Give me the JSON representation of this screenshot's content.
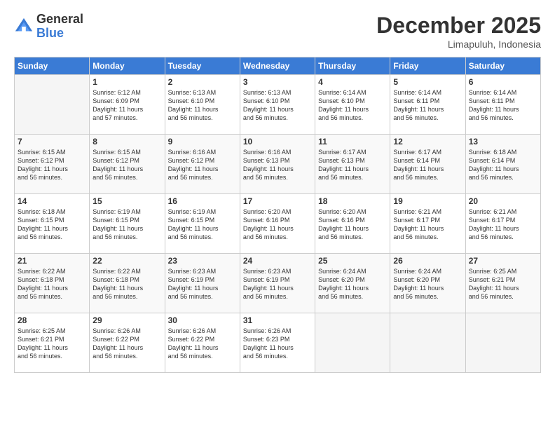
{
  "logo": {
    "general": "General",
    "blue": "Blue"
  },
  "title": "December 2025",
  "location": "Limapuluh, Indonesia",
  "days_header": [
    "Sunday",
    "Monday",
    "Tuesday",
    "Wednesday",
    "Thursday",
    "Friday",
    "Saturday"
  ],
  "weeks": [
    [
      {
        "day": "",
        "info": ""
      },
      {
        "day": "1",
        "info": "Sunrise: 6:12 AM\nSunset: 6:09 PM\nDaylight: 11 hours\nand 57 minutes."
      },
      {
        "day": "2",
        "info": "Sunrise: 6:13 AM\nSunset: 6:10 PM\nDaylight: 11 hours\nand 56 minutes."
      },
      {
        "day": "3",
        "info": "Sunrise: 6:13 AM\nSunset: 6:10 PM\nDaylight: 11 hours\nand 56 minutes."
      },
      {
        "day": "4",
        "info": "Sunrise: 6:14 AM\nSunset: 6:10 PM\nDaylight: 11 hours\nand 56 minutes."
      },
      {
        "day": "5",
        "info": "Sunrise: 6:14 AM\nSunset: 6:11 PM\nDaylight: 11 hours\nand 56 minutes."
      },
      {
        "day": "6",
        "info": "Sunrise: 6:14 AM\nSunset: 6:11 PM\nDaylight: 11 hours\nand 56 minutes."
      }
    ],
    [
      {
        "day": "7",
        "info": "Sunrise: 6:15 AM\nSunset: 6:12 PM\nDaylight: 11 hours\nand 56 minutes."
      },
      {
        "day": "8",
        "info": "Sunrise: 6:15 AM\nSunset: 6:12 PM\nDaylight: 11 hours\nand 56 minutes."
      },
      {
        "day": "9",
        "info": "Sunrise: 6:16 AM\nSunset: 6:12 PM\nDaylight: 11 hours\nand 56 minutes."
      },
      {
        "day": "10",
        "info": "Sunrise: 6:16 AM\nSunset: 6:13 PM\nDaylight: 11 hours\nand 56 minutes."
      },
      {
        "day": "11",
        "info": "Sunrise: 6:17 AM\nSunset: 6:13 PM\nDaylight: 11 hours\nand 56 minutes."
      },
      {
        "day": "12",
        "info": "Sunrise: 6:17 AM\nSunset: 6:14 PM\nDaylight: 11 hours\nand 56 minutes."
      },
      {
        "day": "13",
        "info": "Sunrise: 6:18 AM\nSunset: 6:14 PM\nDaylight: 11 hours\nand 56 minutes."
      }
    ],
    [
      {
        "day": "14",
        "info": "Sunrise: 6:18 AM\nSunset: 6:15 PM\nDaylight: 11 hours\nand 56 minutes."
      },
      {
        "day": "15",
        "info": "Sunrise: 6:19 AM\nSunset: 6:15 PM\nDaylight: 11 hours\nand 56 minutes."
      },
      {
        "day": "16",
        "info": "Sunrise: 6:19 AM\nSunset: 6:15 PM\nDaylight: 11 hours\nand 56 minutes."
      },
      {
        "day": "17",
        "info": "Sunrise: 6:20 AM\nSunset: 6:16 PM\nDaylight: 11 hours\nand 56 minutes."
      },
      {
        "day": "18",
        "info": "Sunrise: 6:20 AM\nSunset: 6:16 PM\nDaylight: 11 hours\nand 56 minutes."
      },
      {
        "day": "19",
        "info": "Sunrise: 6:21 AM\nSunset: 6:17 PM\nDaylight: 11 hours\nand 56 minutes."
      },
      {
        "day": "20",
        "info": "Sunrise: 6:21 AM\nSunset: 6:17 PM\nDaylight: 11 hours\nand 56 minutes."
      }
    ],
    [
      {
        "day": "21",
        "info": "Sunrise: 6:22 AM\nSunset: 6:18 PM\nDaylight: 11 hours\nand 56 minutes."
      },
      {
        "day": "22",
        "info": "Sunrise: 6:22 AM\nSunset: 6:18 PM\nDaylight: 11 hours\nand 56 minutes."
      },
      {
        "day": "23",
        "info": "Sunrise: 6:23 AM\nSunset: 6:19 PM\nDaylight: 11 hours\nand 56 minutes."
      },
      {
        "day": "24",
        "info": "Sunrise: 6:23 AM\nSunset: 6:19 PM\nDaylight: 11 hours\nand 56 minutes."
      },
      {
        "day": "25",
        "info": "Sunrise: 6:24 AM\nSunset: 6:20 PM\nDaylight: 11 hours\nand 56 minutes."
      },
      {
        "day": "26",
        "info": "Sunrise: 6:24 AM\nSunset: 6:20 PM\nDaylight: 11 hours\nand 56 minutes."
      },
      {
        "day": "27",
        "info": "Sunrise: 6:25 AM\nSunset: 6:21 PM\nDaylight: 11 hours\nand 56 minutes."
      }
    ],
    [
      {
        "day": "28",
        "info": "Sunrise: 6:25 AM\nSunset: 6:21 PM\nDaylight: 11 hours\nand 56 minutes."
      },
      {
        "day": "29",
        "info": "Sunrise: 6:26 AM\nSunset: 6:22 PM\nDaylight: 11 hours\nand 56 minutes."
      },
      {
        "day": "30",
        "info": "Sunrise: 6:26 AM\nSunset: 6:22 PM\nDaylight: 11 hours\nand 56 minutes."
      },
      {
        "day": "31",
        "info": "Sunrise: 6:26 AM\nSunset: 6:23 PM\nDaylight: 11 hours\nand 56 minutes."
      },
      {
        "day": "",
        "info": ""
      },
      {
        "day": "",
        "info": ""
      },
      {
        "day": "",
        "info": ""
      }
    ]
  ]
}
